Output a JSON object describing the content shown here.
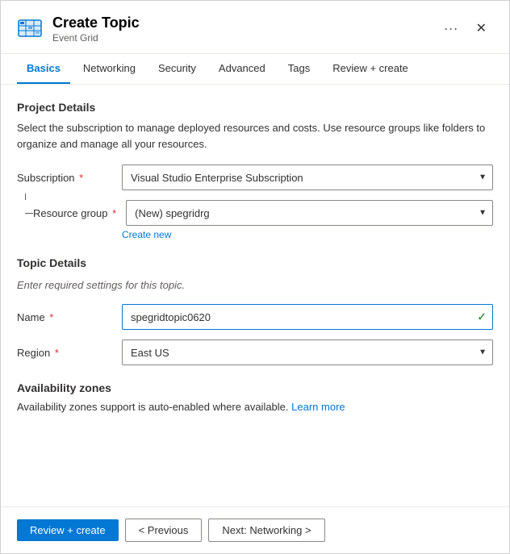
{
  "header": {
    "title": "Create Topic",
    "subtitle": "Event Grid",
    "ellipsis_label": "···",
    "close_label": "✕"
  },
  "tabs": [
    {
      "id": "basics",
      "label": "Basics",
      "active": true
    },
    {
      "id": "networking",
      "label": "Networking",
      "active": false
    },
    {
      "id": "security",
      "label": "Security",
      "active": false
    },
    {
      "id": "advanced",
      "label": "Advanced",
      "active": false
    },
    {
      "id": "tags",
      "label": "Tags",
      "active": false
    },
    {
      "id": "review",
      "label": "Review + create",
      "active": false
    }
  ],
  "project_details": {
    "section_title": "Project Details",
    "description": "Select the subscription to manage deployed resources and costs. Use resource groups like folders to organize and manage all your resources.",
    "subscription_label": "Subscription",
    "subscription_value": "Visual Studio Enterprise Subscription",
    "resource_group_label": "Resource group",
    "resource_group_value": "(New) spegridrg",
    "create_new_label": "Create new"
  },
  "topic_details": {
    "section_title": "Topic Details",
    "note": "Enter required settings for this topic.",
    "name_label": "Name",
    "name_value": "spegridtopic0620",
    "region_label": "Region",
    "region_value": "East US"
  },
  "availability_zones": {
    "section_title": "Availability zones",
    "description": "Availability zones support is auto-enabled where available.",
    "learn_more_label": "Learn more"
  },
  "footer": {
    "review_create_label": "Review + create",
    "previous_label": "< Previous",
    "next_label": "Next: Networking >"
  },
  "icons": {
    "chevron_down": "▼",
    "checkmark": "✓",
    "close": "✕",
    "ellipsis": "···"
  }
}
